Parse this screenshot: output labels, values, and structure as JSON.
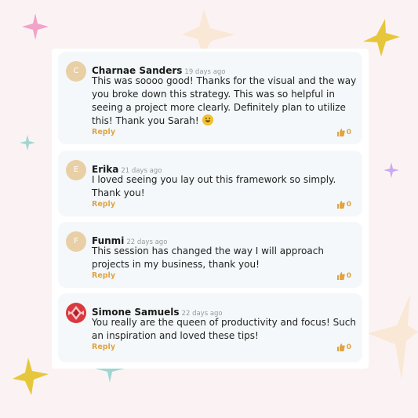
{
  "comments": [
    {
      "initial": "C",
      "name": "Charnae Sanders",
      "time": "19 days ago",
      "text": "This was soooo good! Thanks for the visual and the way you broke down this strategy. This was so helpful in seeing a project more clearly. Definitely plan to utilize this! Thank you Sarah!",
      "reply": "Reply",
      "likes": "0"
    },
    {
      "initial": "E",
      "name": "Erika",
      "time": "21 days ago",
      "text": "I loved seeing you lay out this framework so simply. Thank you!",
      "reply": "Reply",
      "likes": "0"
    },
    {
      "initial": "F",
      "name": "Funmi",
      "time": "22 days ago",
      "text": "This session has changed the way I will approach projects in my business, thank you!",
      "reply": "Reply",
      "likes": "0"
    },
    {
      "initial": "",
      "name": "Simone Samuels",
      "time": "22 days ago",
      "text": "You really are the queen of productivity and focus! Such an inspiration and loved these tips!",
      "reply": "Reply",
      "likes": "0"
    }
  ],
  "icons": {
    "like": "thumbs-up-icon",
    "emoji": "grinning-face-icon",
    "stars": "decorative-star-icon"
  },
  "colors": {
    "background": "#fbf3f3",
    "accent": "#e0a443",
    "card": "#f4f8fa",
    "avatar": "#e9cfa5"
  }
}
